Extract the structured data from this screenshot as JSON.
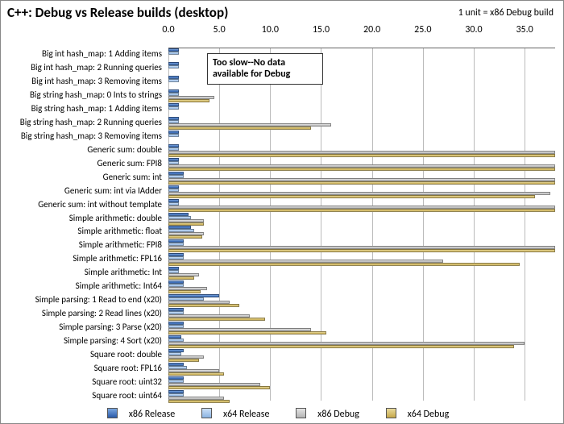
{
  "chart_data": {
    "type": "bar",
    "title": "C++: Debug vs Release builds (desktop)",
    "unit_note": "1 unit = x86 Debug build",
    "xlabel": "",
    "ylabel": "",
    "xlim": [
      0,
      38
    ],
    "ticks": [
      0.0,
      5.0,
      10.0,
      15.0,
      20.0,
      25.0,
      30.0,
      35.0
    ],
    "callout": "Too slow--No data available for Debug",
    "overflow_value": 40,
    "categories": [
      "Big int hash_map: 1 Adding items",
      "Big int hash_map: 2 Running queries",
      "Big int hash_map: 3 Removing items",
      "Big string hash_map: 0 Ints to strings",
      "Big string hash_map: 1 Adding items",
      "Big string hash_map: 2 Running queries",
      "Big string hash_map: 3 Removing items",
      "Generic sum: double",
      "Generic sum: FPI8",
      "Generic sum: int",
      "Generic sum: int via IAdder",
      "Generic sum: int without template",
      "Simple arithmetic: double",
      "Simple arithmetic: float",
      "Simple arithmetic: FPI8",
      "Simple arithmetic: FPL16",
      "Simple arithmetic: Int",
      "Simple arithmetic: Int64",
      "Simple parsing: 1 Read to end (x20)",
      "Simple parsing: 2 Read lines (x20)",
      "Simple parsing: 3 Parse (x20)",
      "Simple parsing: 4 Sort (x20)",
      "Square root: double",
      "Square root: FPL16",
      "Square root: uint32",
      "Square root: uint64"
    ],
    "series": [
      {
        "name": "x86 Release",
        "color": "#3d6fb5",
        "values": [
          1.0,
          1.0,
          1.0,
          1.0,
          1.0,
          1.0,
          1.0,
          1.0,
          1.0,
          1.5,
          1.0,
          1.0,
          2.0,
          2.2,
          1.5,
          1.5,
          1.0,
          1.5,
          5.0,
          1.5,
          1.5,
          1.3,
          1.5,
          1.5,
          1.5,
          1.5
        ]
      },
      {
        "name": "x64 Release",
        "color": "#a8c6ec",
        "values": [
          1.0,
          1.0,
          1.0,
          1.0,
          1.0,
          1.0,
          1.0,
          1.0,
          1.0,
          1.5,
          1.0,
          1.0,
          2.2,
          2.5,
          1.5,
          1.5,
          1.0,
          1.5,
          3.5,
          1.5,
          1.5,
          1.5,
          1.3,
          1.8,
          1.5,
          1.5
        ]
      },
      {
        "name": "x86 Debug",
        "color": "#c7c7c7",
        "too_slow": [
          4,
          6
        ],
        "values": [
          null,
          null,
          null,
          4.5,
          null,
          16.0,
          null,
          40,
          40,
          40,
          37.5,
          40,
          3.5,
          3.5,
          40,
          27.0,
          3.0,
          3.8,
          6.0,
          8.0,
          14.0,
          35.0,
          3.5,
          5.0,
          9.0,
          5.5
        ]
      },
      {
        "name": "x64 Debug",
        "color": "#c6a84a",
        "too_slow": [
          4,
          6
        ],
        "values": [
          null,
          null,
          null,
          4.0,
          null,
          14.0,
          null,
          40,
          40,
          40,
          36.0,
          40,
          3.5,
          3.3,
          40,
          34.5,
          2.5,
          3.2,
          7.0,
          9.5,
          15.5,
          34.0,
          3.0,
          5.5,
          10.0,
          6.0
        ]
      }
    ],
    "legend": [
      "x86 Release",
      "x64 Release",
      "x86 Debug",
      "x64 Debug"
    ]
  }
}
